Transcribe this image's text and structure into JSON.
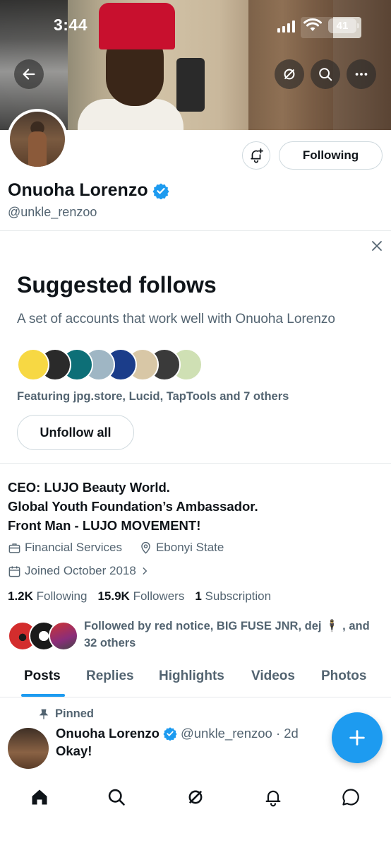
{
  "status_bar": {
    "time": "3:44",
    "battery": "41"
  },
  "profile": {
    "name": "Onuoha Lorenzo",
    "handle": "@unkle_renzoo",
    "following_button": "Following",
    "verified_color": "#1d9bf0"
  },
  "suggested": {
    "close_label": "×",
    "title": "Suggested follows",
    "subtitle": "A set of accounts that work well with Onuoha Lorenzo",
    "featuring": "Featuring jpg.store, Lucid, TapTools and 7 others",
    "unfollow_label": "Unfollow all",
    "avatars": [
      "#f7d843",
      "#2a2a2a",
      "#0d6f77",
      "#9fb6c4",
      "#1b3d8a",
      "#d8c7a6",
      "#3a3a3a",
      "#cfe0b4"
    ]
  },
  "bio": {
    "line1": "CEO: LUJO Beauty World.",
    "line2": "Global Youth Foundation’s Ambassador.",
    "line3": "Front Man - LUJO MOVEMENT!"
  },
  "meta": {
    "category": "Financial Services",
    "location": "Ebonyi State",
    "joined": "Joined October 2018"
  },
  "counts": {
    "following_num": "1.2K",
    "following_label": "Following",
    "followers_num": "15.9K",
    "followers_label": "Followers",
    "subs_num": "1",
    "subs_label": "Subscription"
  },
  "followed_by": {
    "text": "Followed by red notice, BIG FUSE JNR, dej 🕴 , and 32 others"
  },
  "tabs": [
    "Posts",
    "Replies",
    "Highlights",
    "Videos",
    "Photos"
  ],
  "post": {
    "pinned_label": "Pinned",
    "author": "Onuoha Lorenzo",
    "handle_time": "@unkle_renzoo · 2d",
    "text": "Okay!"
  },
  "colors": {
    "accent": "#1d9bf0",
    "muted": "#536471"
  }
}
